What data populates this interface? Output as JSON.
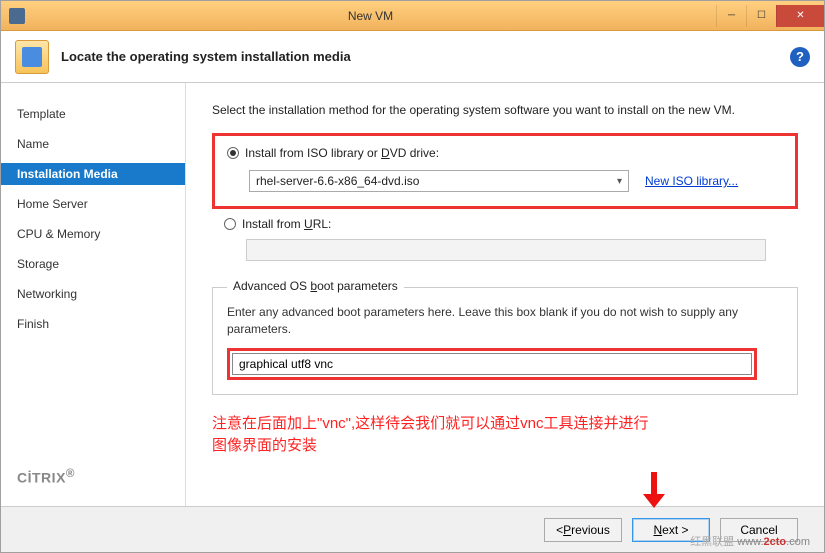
{
  "titlebar": {
    "title": "New VM"
  },
  "header": {
    "title": "Locate the operating system installation media"
  },
  "sidebar": {
    "items": [
      {
        "label": "Template"
      },
      {
        "label": "Name"
      },
      {
        "label": "Installation Media",
        "selected": true
      },
      {
        "label": "Home Server"
      },
      {
        "label": "CPU & Memory"
      },
      {
        "label": "Storage"
      },
      {
        "label": "Networking"
      },
      {
        "label": "Finish"
      }
    ],
    "logo_pre": "CİTR",
    "logo_dot": "I",
    "logo_post": "X"
  },
  "main": {
    "instruction": "Select the installation method for the operating system software you want to install on the new VM.",
    "radio_iso_pre": "Install from ISO library or ",
    "radio_iso_letter": "D",
    "radio_iso_post": "VD drive:",
    "iso_selected": "rhel-server-6.6-x86_64-dvd.iso",
    "new_iso_link": "New ISO library...",
    "radio_url_pre": "Install from ",
    "radio_url_letter": "U",
    "radio_url_post": "RL:",
    "fieldset_legend_pre": "Advanced OS ",
    "fieldset_legend_letter": "b",
    "fieldset_legend_post": "oot parameters",
    "fieldset_desc": "Enter any advanced boot parameters here. Leave this box blank if you do not wish to supply any parameters.",
    "boot_value": "graphical utf8 vnc",
    "annotation_line1": "注意在后面加上\"vnc\",这样待会我们就可以通过vnc工具连接并进行",
    "annotation_line2": "图像界面的安装"
  },
  "footer": {
    "previous_pre": "< ",
    "previous_letter": "P",
    "previous_post": "revious",
    "next_letter": "N",
    "next_post": "ext >",
    "cancel": "Cancel",
    "watermark_pre": "www.",
    "watermark_mid": "2cto",
    "watermark_post": ".com",
    "watermark_cn": "红黑联盟"
  }
}
